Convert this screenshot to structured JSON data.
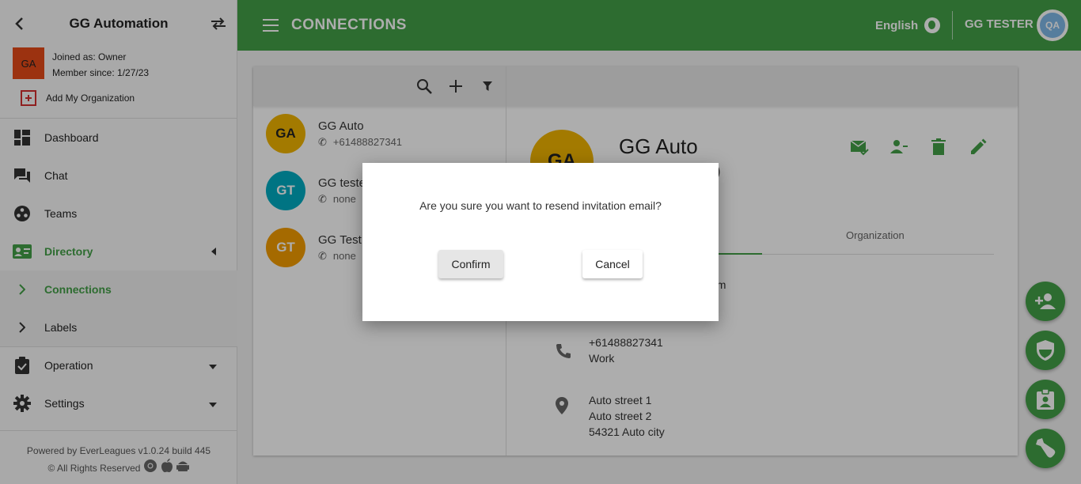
{
  "sidebar": {
    "org_title": "GG Automation",
    "avatar_initials": "GA",
    "joined_as": "Joined as: Owner",
    "member_since": "Member since: 1/27/23",
    "add_org_label": "Add My Organization",
    "nav": {
      "dashboard": "Dashboard",
      "chat": "Chat",
      "teams": "Teams",
      "directory": "Directory",
      "connections": "Connections",
      "labels": "Labels",
      "operation": "Operation",
      "settings": "Settings"
    },
    "footer_powered": "Powered by EverLeagues v1.0.24 build 445",
    "footer_rights": "© All Rights Reserved"
  },
  "header": {
    "title": "CONNECTIONS",
    "language": "English",
    "user_name": "GG TESTER",
    "user_avatar_text": "QA"
  },
  "contacts": [
    {
      "initials": "GA",
      "name": "GG Auto",
      "phone": "+61488827341",
      "color": "#f0b400"
    },
    {
      "initials": "GT",
      "name": "GG teste",
      "phone": "none",
      "color": "#00acc1"
    },
    {
      "initials": "GT",
      "name": "GG Test",
      "phone": "none",
      "color": "#f39c00"
    }
  ],
  "detail": {
    "avatar_initials": "GA",
    "name": "GG Auto",
    "name_suffix": ")",
    "tab_organization": "Organization",
    "email_fragment": "om",
    "phone": "+61488827341",
    "phone_type": "Work",
    "address_line1": "Auto street 1",
    "address_line2": "Auto street 2",
    "address_line3": "54321 Auto city"
  },
  "dialog": {
    "message": "Are you sure you want to resend invitation email?",
    "confirm_label": "Confirm",
    "cancel_label": "Cancel"
  },
  "colors": {
    "primary": "#43a047",
    "org_avatar": "#e64a19"
  }
}
